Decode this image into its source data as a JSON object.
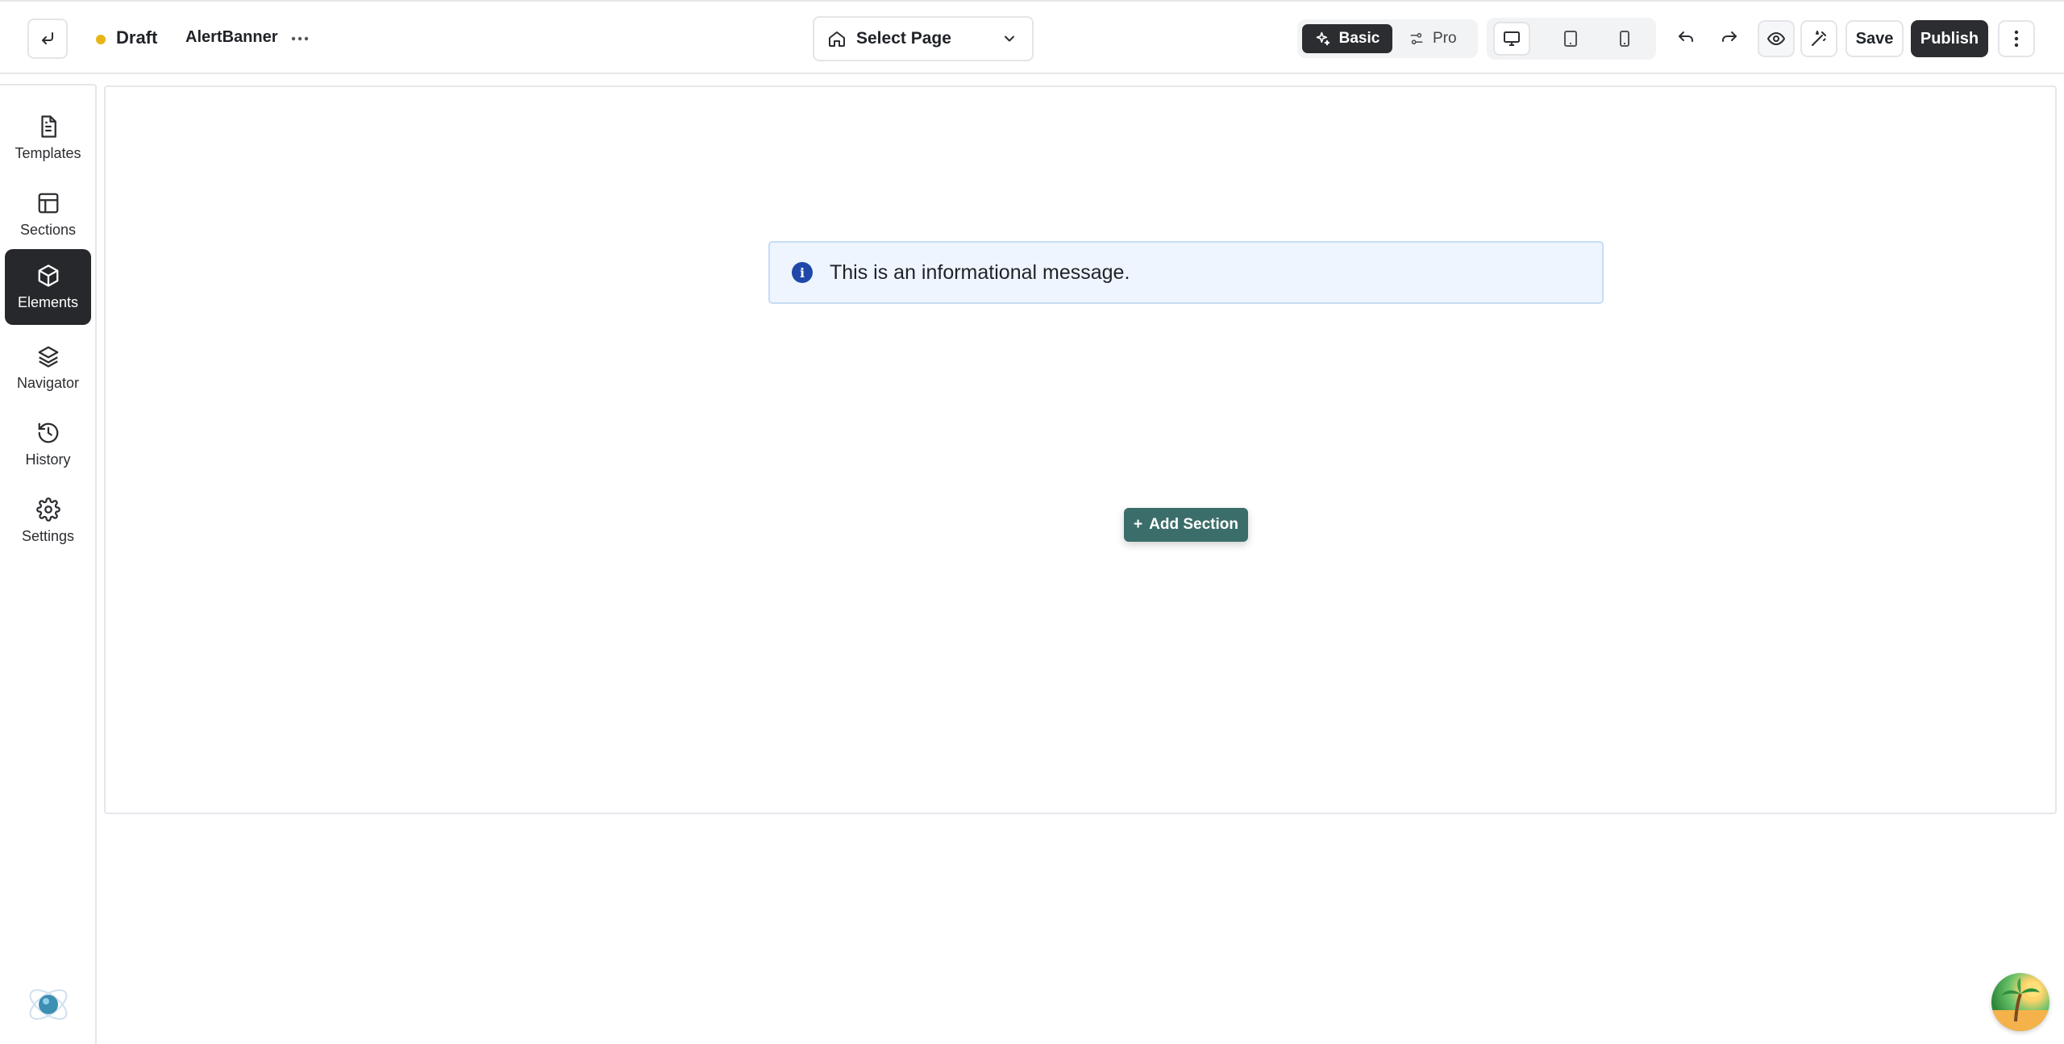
{
  "header": {
    "status": "Draft",
    "status_color": "#e8b418",
    "document_name": "AlertBanner",
    "page_selector": "Select Page",
    "mode_basic": "Basic",
    "mode_pro": "Pro",
    "save_label": "Save",
    "publish_label": "Publish"
  },
  "sidebar": {
    "items": [
      {
        "label": "Templates",
        "icon": "file-icon"
      },
      {
        "label": "Sections",
        "icon": "layout-icon"
      },
      {
        "label": "Elements",
        "icon": "cube-icon",
        "active": true
      },
      {
        "label": "Navigator",
        "icon": "layers-icon"
      },
      {
        "label": "History",
        "icon": "history-icon"
      },
      {
        "label": "Settings",
        "icon": "gear-icon"
      }
    ]
  },
  "canvas": {
    "alert_message": "This is an informational message.",
    "add_section_label": "Add Section"
  },
  "colors": {
    "accent_dark": "#2b2d31",
    "add_section_bg": "#3b6e6a",
    "alert_bg": "#eef5fe",
    "info_icon": "#1f48a8"
  }
}
